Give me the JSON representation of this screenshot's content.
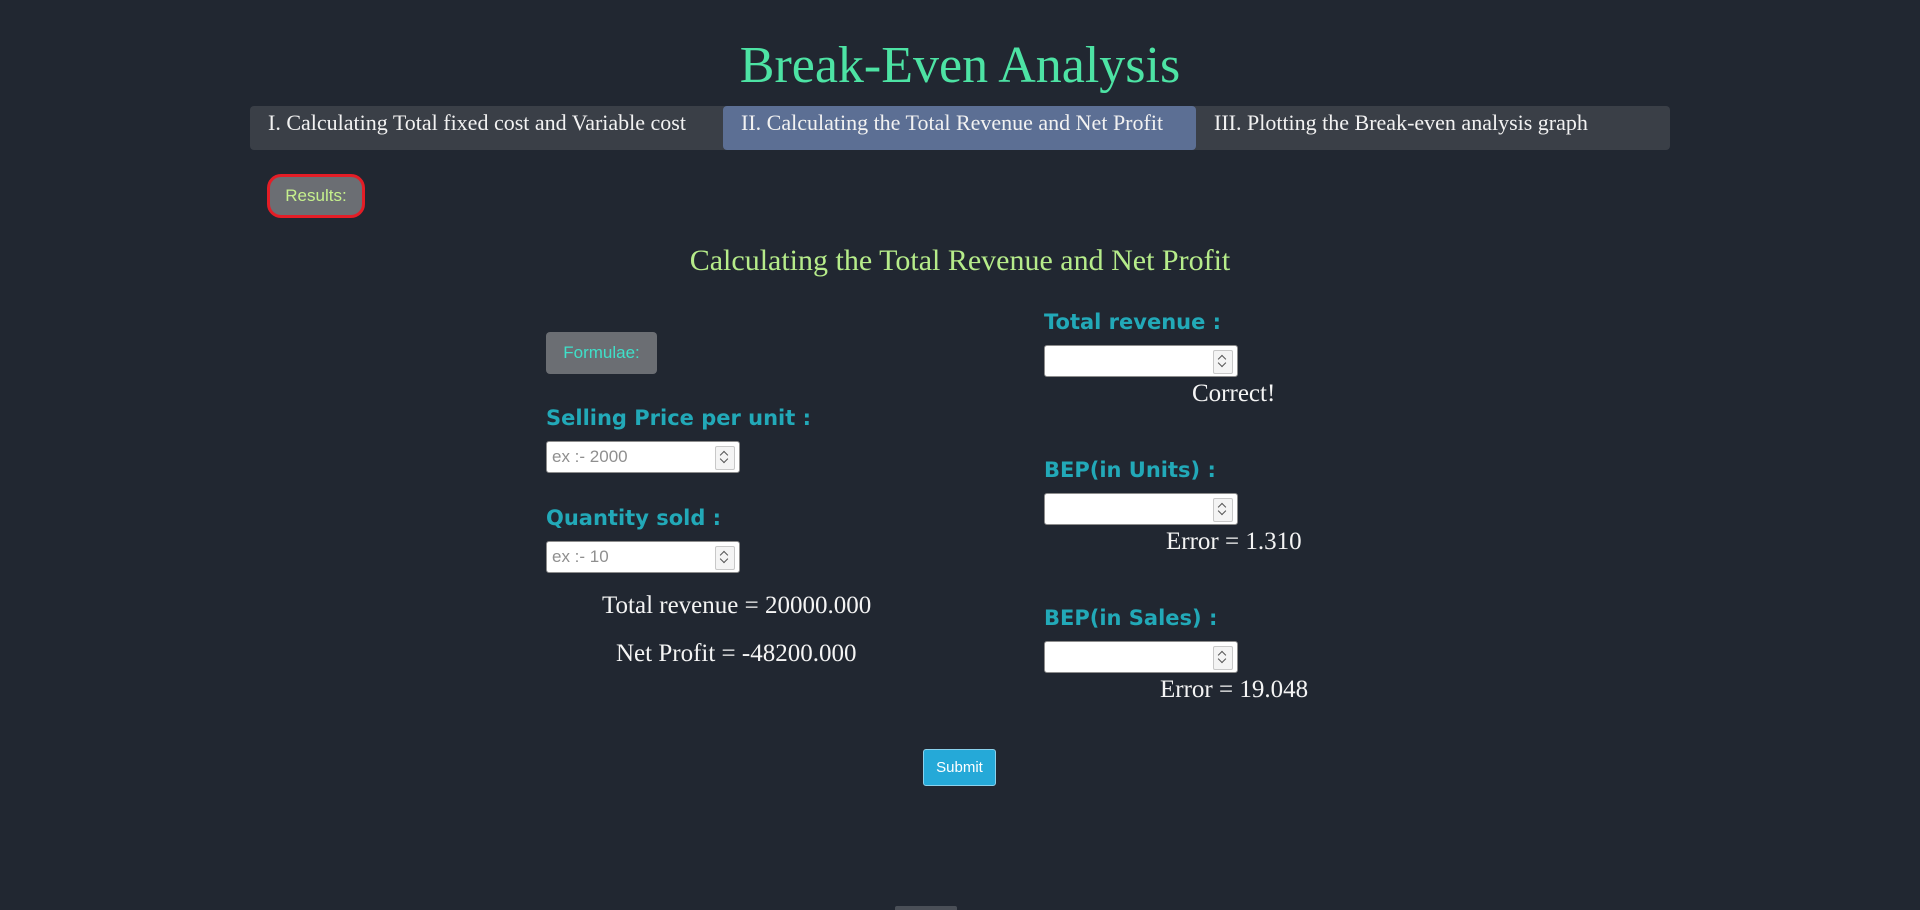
{
  "page": {
    "title": "Break-Even Analysis",
    "subtitle": "Calculating the Total Revenue and Net Profit"
  },
  "tabs": [
    {
      "label": "I. Calculating Total fixed cost and Variable cost",
      "active": false
    },
    {
      "label": "II. Calculating the Total Revenue and Net Profit",
      "active": true
    },
    {
      "label": "III. Plotting the Break-even analysis graph",
      "active": false
    }
  ],
  "buttons": {
    "results_label": "Results:",
    "formulae_label": "Formulae:",
    "submit_label": "Submit"
  },
  "left_form": {
    "selling_price": {
      "label": "Selling Price per unit :",
      "value": "",
      "placeholder": "ex :- 2000"
    },
    "quantity": {
      "label": "Quantity sold :",
      "value": "",
      "placeholder": "ex :- 10"
    },
    "total_revenue_text": "Total revenue = 20000.000",
    "net_profit_text": "Net Profit = -48200.000"
  },
  "right_form": {
    "total_revenue": {
      "label": "Total revenue :",
      "value": "",
      "feedback": "Correct!"
    },
    "bep_units": {
      "label": "BEP(in Units) :",
      "value": "",
      "feedback": "Error = 1.310"
    },
    "bep_sales": {
      "label": "BEP(in Sales) :",
      "value": "",
      "feedback": "Error = 19.048"
    }
  },
  "colors": {
    "background": "#212731",
    "title": "#4de3a4",
    "subtitle": "#b6ec8a",
    "label": "#22a9b8",
    "active_tab": "#5c6f94",
    "submit": "#25a9d8",
    "results_border": "#e41d26"
  }
}
